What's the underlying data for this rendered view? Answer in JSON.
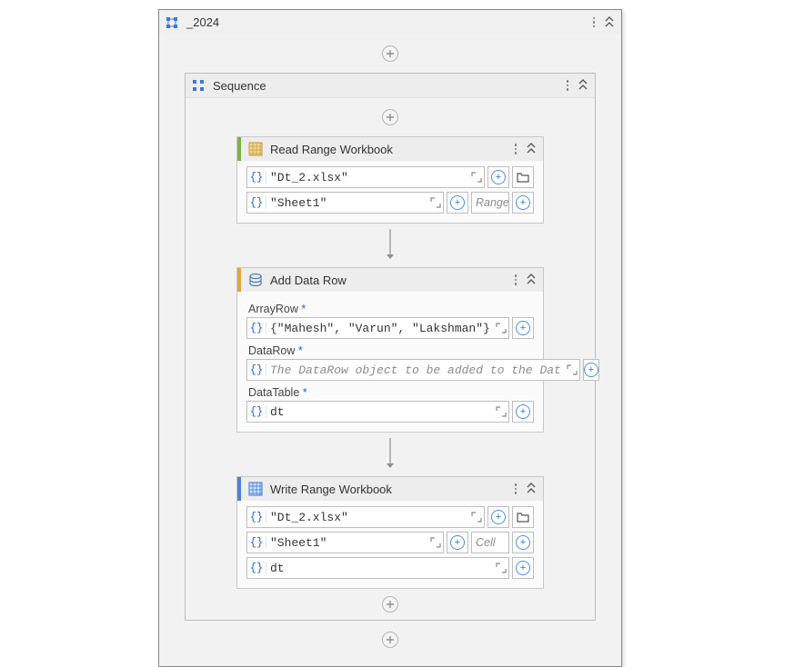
{
  "outer": {
    "title": "_2024"
  },
  "sequence": {
    "title": "Sequence"
  },
  "readRange": {
    "title": "Read Range Workbook",
    "fileValue": "\"Dt_2.xlsx\"",
    "sheetValue": "\"Sheet1\"",
    "rangePlaceholder": "Range"
  },
  "addDataRow": {
    "title": "Add Data Row",
    "arrayRowLabel": "ArrayRow",
    "arrayRowValue": "{\"Mahesh\", \"Varun\", \"Lakshman\"}",
    "dataRowLabel": "DataRow",
    "dataRowPlaceholder": "The DataRow object to be added to the Dat",
    "dataTableLabel": "DataTable",
    "dataTableValue": "dt"
  },
  "writeRange": {
    "title": "Write Range Workbook",
    "fileValue": "\"Dt_2.xlsx\"",
    "sheetValue": "\"Sheet1\"",
    "cellPlaceholder": "Cell",
    "dataValue": "dt"
  }
}
